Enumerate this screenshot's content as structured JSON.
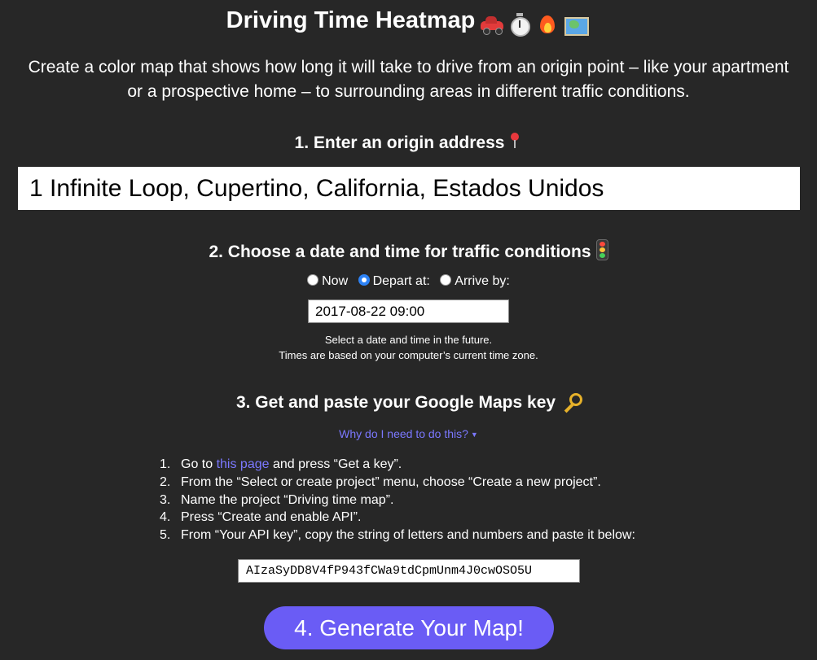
{
  "header": {
    "title": "Driving Time Heatmap",
    "title_icons": [
      "car-icon",
      "stopwatch-icon",
      "fire-icon",
      "map-icon"
    ],
    "intro": "Create a color map that shows how long it will take to drive from an origin point – like your apartment or a prospective home – to surrounding areas in different traffic conditions."
  },
  "step1": {
    "heading": "1. Enter an origin address",
    "icon": "pin-icon",
    "address_value": "1 Infinite Loop, Cupertino, California, Estados Unidos"
  },
  "step2": {
    "heading": "2. Choose a date and time for traffic conditions",
    "icon": "traffic-light-icon",
    "options": [
      {
        "label": "Now",
        "selected": false
      },
      {
        "label": "Depart at:",
        "selected": true
      },
      {
        "label": "Arrive by:",
        "selected": false
      }
    ],
    "datetime_value": "2017-08-22 09:00",
    "hint_line1": "Select a date and time in the future.",
    "hint_line2": "Times are based on your computer’s current time zone."
  },
  "step3": {
    "heading": "3. Get and paste your Google Maps key",
    "icon": "key-icon",
    "why_link": "Why do I need to do this?",
    "instructions": [
      {
        "num": "1.",
        "before": "Go to ",
        "link": "this page",
        "after": " and press “Get a key”."
      },
      {
        "num": "2.",
        "text": "From the “Select or create project” menu, choose “Create a new project”."
      },
      {
        "num": "3.",
        "text": "Name the project “Driving time map”."
      },
      {
        "num": "4.",
        "text": "Press “Create and enable API”."
      },
      {
        "num": "5.",
        "text": "From “Your API key”, copy the string of letters and numbers and paste it below:"
      }
    ],
    "api_key_value": "AIzaSyDD8V4fP943fCWa9tdCpmUnm4J0cwOSO5U"
  },
  "step4": {
    "button_label": "4. Generate Your Map!"
  },
  "colors": {
    "background": "#272727",
    "accent": "#6a5cf5",
    "link": "#7b78ff",
    "radio_selected": "#2d82f5"
  }
}
